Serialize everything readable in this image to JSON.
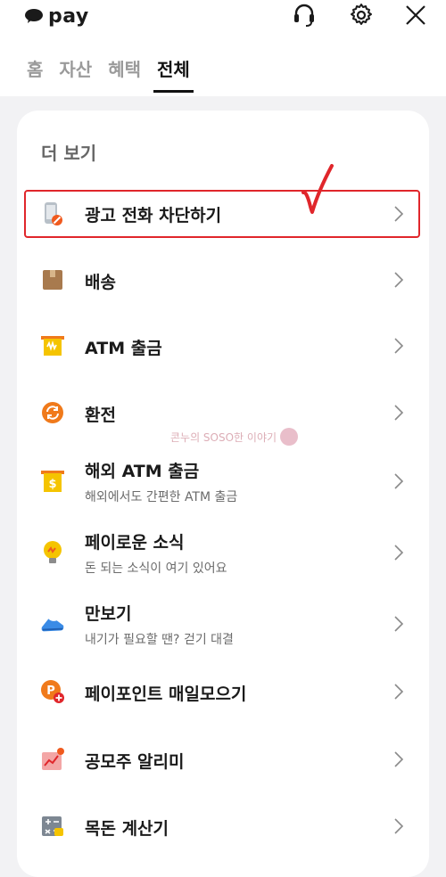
{
  "header": {
    "logo_text": "pay",
    "tabs": [
      {
        "label": "홈"
      },
      {
        "label": "자산"
      },
      {
        "label": "혜택"
      },
      {
        "label": "전체"
      }
    ]
  },
  "section": {
    "title": "더 보기"
  },
  "items": [
    {
      "label": "광고 전화 차단하기",
      "icon": "phone-block-icon"
    },
    {
      "label": "배송",
      "icon": "package-icon"
    },
    {
      "label": "ATM 출금",
      "icon": "atm-icon"
    },
    {
      "label": "환전",
      "icon": "exchange-icon"
    },
    {
      "label": "해외 ATM 출금",
      "sub": "해외에서도 간편한 ATM 출금",
      "icon": "overseas-atm-icon"
    },
    {
      "label": "페이로운 소식",
      "sub": "돈 되는 소식이 여기 있어요",
      "icon": "lightbulb-icon"
    },
    {
      "label": "만보기",
      "sub": "내기가 필요할 땐? 걷기 대결",
      "icon": "sneaker-icon"
    },
    {
      "label": "페이포인트 매일모으기",
      "icon": "point-icon"
    },
    {
      "label": "공모주 알리미",
      "icon": "ipo-alert-icon"
    },
    {
      "label": "목돈 계산기",
      "icon": "calculator-icon"
    }
  ],
  "watermark": {
    "text": "콘누의 SOSO한 이야기"
  },
  "colors": {
    "highlight": "#e0262b",
    "accent_yellow": "#f5c400",
    "accent_orange": "#f07a1b"
  }
}
